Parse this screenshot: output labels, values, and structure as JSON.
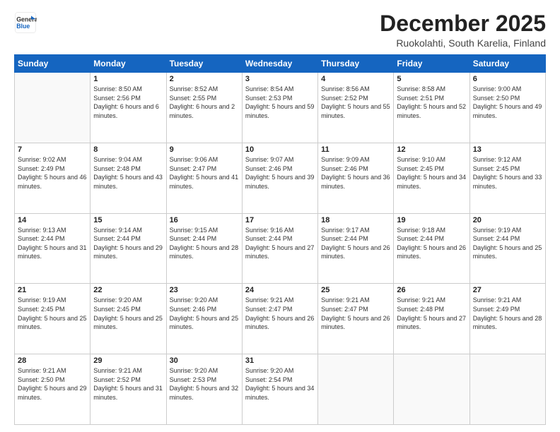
{
  "logo": {
    "line1": "General",
    "line2": "Blue"
  },
  "header": {
    "title": "December 2025",
    "subtitle": "Ruokolahti, South Karelia, Finland"
  },
  "weekdays": [
    "Sunday",
    "Monday",
    "Tuesday",
    "Wednesday",
    "Thursday",
    "Friday",
    "Saturday"
  ],
  "weeks": [
    [
      {
        "day": null
      },
      {
        "day": "1",
        "sunrise": "Sunrise: 8:50 AM",
        "sunset": "Sunset: 2:56 PM",
        "daylight": "Daylight: 6 hours and 6 minutes."
      },
      {
        "day": "2",
        "sunrise": "Sunrise: 8:52 AM",
        "sunset": "Sunset: 2:55 PM",
        "daylight": "Daylight: 6 hours and 2 minutes."
      },
      {
        "day": "3",
        "sunrise": "Sunrise: 8:54 AM",
        "sunset": "Sunset: 2:53 PM",
        "daylight": "Daylight: 5 hours and 59 minutes."
      },
      {
        "day": "4",
        "sunrise": "Sunrise: 8:56 AM",
        "sunset": "Sunset: 2:52 PM",
        "daylight": "Daylight: 5 hours and 55 minutes."
      },
      {
        "day": "5",
        "sunrise": "Sunrise: 8:58 AM",
        "sunset": "Sunset: 2:51 PM",
        "daylight": "Daylight: 5 hours and 52 minutes."
      },
      {
        "day": "6",
        "sunrise": "Sunrise: 9:00 AM",
        "sunset": "Sunset: 2:50 PM",
        "daylight": "Daylight: 5 hours and 49 minutes."
      }
    ],
    [
      {
        "day": "7",
        "sunrise": "Sunrise: 9:02 AM",
        "sunset": "Sunset: 2:49 PM",
        "daylight": "Daylight: 5 hours and 46 minutes."
      },
      {
        "day": "8",
        "sunrise": "Sunrise: 9:04 AM",
        "sunset": "Sunset: 2:48 PM",
        "daylight": "Daylight: 5 hours and 43 minutes."
      },
      {
        "day": "9",
        "sunrise": "Sunrise: 9:06 AM",
        "sunset": "Sunset: 2:47 PM",
        "daylight": "Daylight: 5 hours and 41 minutes."
      },
      {
        "day": "10",
        "sunrise": "Sunrise: 9:07 AM",
        "sunset": "Sunset: 2:46 PM",
        "daylight": "Daylight: 5 hours and 39 minutes."
      },
      {
        "day": "11",
        "sunrise": "Sunrise: 9:09 AM",
        "sunset": "Sunset: 2:46 PM",
        "daylight": "Daylight: 5 hours and 36 minutes."
      },
      {
        "day": "12",
        "sunrise": "Sunrise: 9:10 AM",
        "sunset": "Sunset: 2:45 PM",
        "daylight": "Daylight: 5 hours and 34 minutes."
      },
      {
        "day": "13",
        "sunrise": "Sunrise: 9:12 AM",
        "sunset": "Sunset: 2:45 PM",
        "daylight": "Daylight: 5 hours and 33 minutes."
      }
    ],
    [
      {
        "day": "14",
        "sunrise": "Sunrise: 9:13 AM",
        "sunset": "Sunset: 2:44 PM",
        "daylight": "Daylight: 5 hours and 31 minutes."
      },
      {
        "day": "15",
        "sunrise": "Sunrise: 9:14 AM",
        "sunset": "Sunset: 2:44 PM",
        "daylight": "Daylight: 5 hours and 29 minutes."
      },
      {
        "day": "16",
        "sunrise": "Sunrise: 9:15 AM",
        "sunset": "Sunset: 2:44 PM",
        "daylight": "Daylight: 5 hours and 28 minutes."
      },
      {
        "day": "17",
        "sunrise": "Sunrise: 9:16 AM",
        "sunset": "Sunset: 2:44 PM",
        "daylight": "Daylight: 5 hours and 27 minutes."
      },
      {
        "day": "18",
        "sunrise": "Sunrise: 9:17 AM",
        "sunset": "Sunset: 2:44 PM",
        "daylight": "Daylight: 5 hours and 26 minutes."
      },
      {
        "day": "19",
        "sunrise": "Sunrise: 9:18 AM",
        "sunset": "Sunset: 2:44 PM",
        "daylight": "Daylight: 5 hours and 26 minutes."
      },
      {
        "day": "20",
        "sunrise": "Sunrise: 9:19 AM",
        "sunset": "Sunset: 2:44 PM",
        "daylight": "Daylight: 5 hours and 25 minutes."
      }
    ],
    [
      {
        "day": "21",
        "sunrise": "Sunrise: 9:19 AM",
        "sunset": "Sunset: 2:45 PM",
        "daylight": "Daylight: 5 hours and 25 minutes."
      },
      {
        "day": "22",
        "sunrise": "Sunrise: 9:20 AM",
        "sunset": "Sunset: 2:45 PM",
        "daylight": "Daylight: 5 hours and 25 minutes."
      },
      {
        "day": "23",
        "sunrise": "Sunrise: 9:20 AM",
        "sunset": "Sunset: 2:46 PM",
        "daylight": "Daylight: 5 hours and 25 minutes."
      },
      {
        "day": "24",
        "sunrise": "Sunrise: 9:21 AM",
        "sunset": "Sunset: 2:47 PM",
        "daylight": "Daylight: 5 hours and 26 minutes."
      },
      {
        "day": "25",
        "sunrise": "Sunrise: 9:21 AM",
        "sunset": "Sunset: 2:47 PM",
        "daylight": "Daylight: 5 hours and 26 minutes."
      },
      {
        "day": "26",
        "sunrise": "Sunrise: 9:21 AM",
        "sunset": "Sunset: 2:48 PM",
        "daylight": "Daylight: 5 hours and 27 minutes."
      },
      {
        "day": "27",
        "sunrise": "Sunrise: 9:21 AM",
        "sunset": "Sunset: 2:49 PM",
        "daylight": "Daylight: 5 hours and 28 minutes."
      }
    ],
    [
      {
        "day": "28",
        "sunrise": "Sunrise: 9:21 AM",
        "sunset": "Sunset: 2:50 PM",
        "daylight": "Daylight: 5 hours and 29 minutes."
      },
      {
        "day": "29",
        "sunrise": "Sunrise: 9:21 AM",
        "sunset": "Sunset: 2:52 PM",
        "daylight": "Daylight: 5 hours and 31 minutes."
      },
      {
        "day": "30",
        "sunrise": "Sunrise: 9:20 AM",
        "sunset": "Sunset: 2:53 PM",
        "daylight": "Daylight: 5 hours and 32 minutes."
      },
      {
        "day": "31",
        "sunrise": "Sunrise: 9:20 AM",
        "sunset": "Sunset: 2:54 PM",
        "daylight": "Daylight: 5 hours and 34 minutes."
      },
      {
        "day": null
      },
      {
        "day": null
      },
      {
        "day": null
      }
    ]
  ]
}
